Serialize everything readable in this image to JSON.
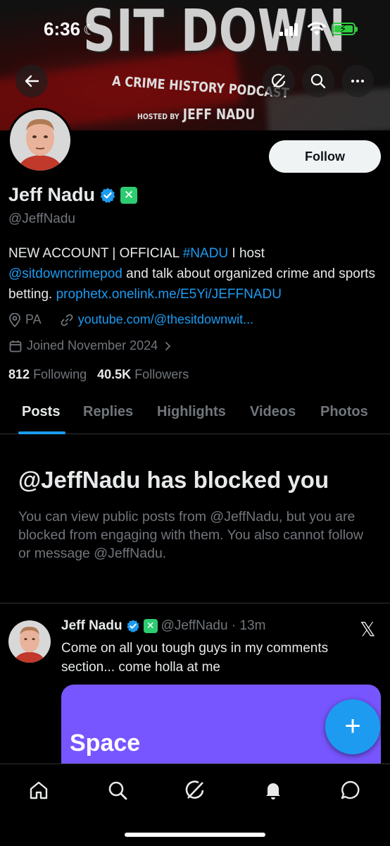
{
  "status_bar": {
    "time": "6:36"
  },
  "banner": {
    "title": "SIT DOWN",
    "subtitle": "A CRIME HISTORY PODCAST",
    "hosted_by": "HOSTED BY",
    "host_name": "JEFF NADU"
  },
  "profile": {
    "name": "Jeff Nadu",
    "handle": "@JeffNadu",
    "follow_label": "Follow",
    "bio": {
      "part1": "NEW ACCOUNT | OFFICIAL ",
      "hashtag": "#NADU",
      "part2": " I host ",
      "mention": "@sitdowncrimepod",
      "part3": " and talk about organized crime and sports betting. ",
      "link": "prophetx.onelink.me/E5Yi/JEFFNADU"
    },
    "location": "PA",
    "website": "youtube.com/@thesitdownwit...",
    "joined": "Joined November 2024",
    "following_count": "812",
    "following_label": "Following",
    "followers_count": "40.5K",
    "followers_label": "Followers"
  },
  "tabs": [
    {
      "label": "Posts"
    },
    {
      "label": "Replies"
    },
    {
      "label": "Highlights"
    },
    {
      "label": "Videos"
    },
    {
      "label": "Photos"
    }
  ],
  "blocked": {
    "title": "@JeffNadu has blocked you",
    "text": "You can view public posts from @JeffNadu, but you are blocked from engaging with them. You also cannot follow or message @JeffNadu."
  },
  "post": {
    "name": "Jeff Nadu",
    "handle_time": "@JeffNadu · 13m",
    "text": "Come on all you tough guys in my comments section... come holla at me",
    "card_label": "Space"
  },
  "colors": {
    "accent": "#1d9bf0",
    "space_purple": "#7856ff",
    "verified_badge": "#1d9bf0",
    "affiliate_badge": "#2ecc71"
  },
  "icons": {
    "top": [
      "back-arrow-icon",
      "grok-icon",
      "search-icon",
      "more-icon"
    ],
    "bottom_nav": [
      "home-icon",
      "search-icon",
      "grok-icon",
      "notifications-icon",
      "messages-icon"
    ]
  }
}
